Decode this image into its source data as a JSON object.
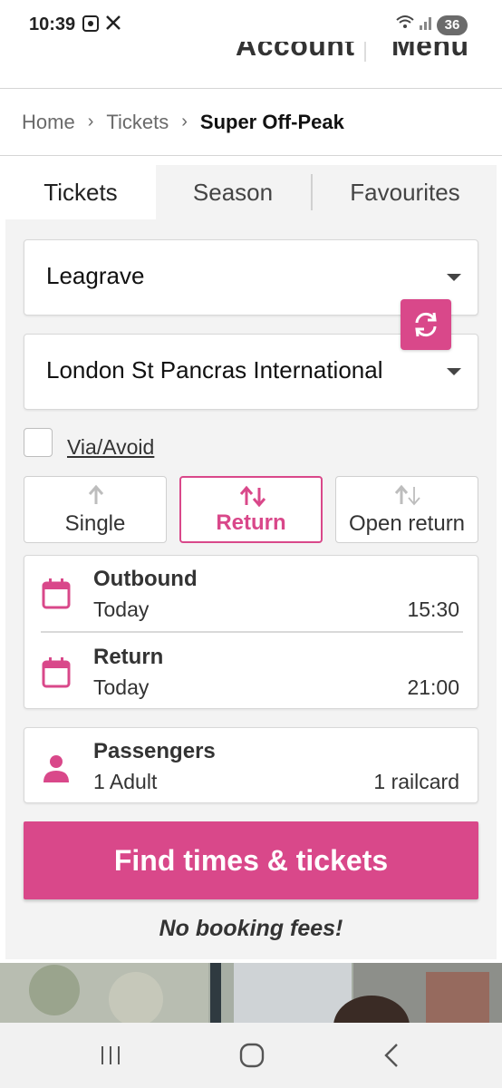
{
  "status_bar": {
    "time": "10:39",
    "battery": "36"
  },
  "header": {
    "account_label": "Account",
    "menu_label": "Menu"
  },
  "breadcrumb": {
    "home": "Home",
    "tickets": "Tickets",
    "current": "Super Off-Peak"
  },
  "tabs": [
    {
      "label": "Tickets",
      "active": true
    },
    {
      "label": "Season",
      "active": false
    },
    {
      "label": "Favourites",
      "active": false
    }
  ],
  "journey": {
    "from": "Leagrave",
    "to": "London St Pancras International",
    "via_label": "Via/Avoid",
    "via_checked": false
  },
  "journey_types": [
    {
      "label": "Single",
      "selected": false
    },
    {
      "label": "Return",
      "selected": true
    },
    {
      "label": "Open return",
      "selected": false
    }
  ],
  "outbound": {
    "title": "Outbound",
    "day": "Today",
    "time": "15:30"
  },
  "return_leg": {
    "title": "Return",
    "day": "Today",
    "time": "21:00"
  },
  "passengers": {
    "title": "Passengers",
    "adults": "1 Adult",
    "railcards": "1 railcard"
  },
  "cta": {
    "label": "Find times & tickets"
  },
  "promo": {
    "text": "No booking fees!"
  },
  "colors": {
    "accent": "#d9488a",
    "panel_bg": "#f3f3f3",
    "text": "#333333"
  }
}
